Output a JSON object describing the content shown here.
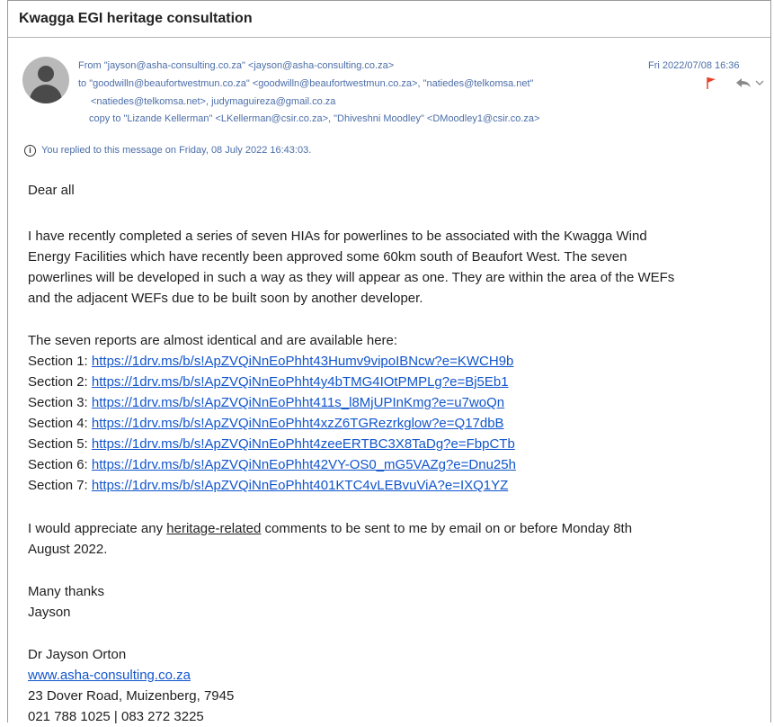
{
  "subject": "Kwagga EGI heritage consultation",
  "header": {
    "from_line": "From \"jayson@asha-consulting.co.za\" <jayson@asha-consulting.co.za>",
    "to_line": "to \"goodwilln@beaufortwestmun.co.za\" <goodwilln@beaufortwestmun.co.za>, \"natiedes@telkomsa.net\"",
    "to_line2": "<natiedes@telkomsa.net>, judymaguireza@gmail.co.za",
    "copy_line": "copy to \"Lizande Kellerman\" <LKellerman@csir.co.za>, \"Dhiveshni Moodley\" <DMoodley1@csir.co.za>",
    "date": "Fri 2022/07/08 16:36"
  },
  "info_bar": "You replied to this message on Friday, 08 July 2022 16:43:03.",
  "body": {
    "greeting": "Dear all",
    "para1_lines": [
      "I have recently completed a series of seven HIAs for powerlines to be associated with the Kwagga Wind",
      "Energy Facilities which have recently been approved some 60km south of Beaufort West. The seven",
      "powerlines will be developed in such a way as they will appear as one. They are within the area of the WEFs",
      "and the adjacent WEFs due to be built soon by another developer."
    ],
    "reports_intro": "The seven reports are almost identical and are available here:",
    "sections": [
      {
        "label": "Section 1: ",
        "url": "https://1drv.ms/b/s!ApZVQiNnEoPhht43Humv9vipoIBNcw?e=KWCH9b"
      },
      {
        "label": "Section 2: ",
        "url": "https://1drv.ms/b/s!ApZVQiNnEoPhht4y4bTMG4IOtPMPLg?e=Bj5Eb1"
      },
      {
        "label": "Section 3: ",
        "url": "https://1drv.ms/b/s!ApZVQiNnEoPhht411s_l8MjUPInKmg?e=u7woQn"
      },
      {
        "label": "Section 4: ",
        "url": "https://1drv.ms/b/s!ApZVQiNnEoPhht4xzZ6TGRezrkglow?e=Q17dbB"
      },
      {
        "label": "Section 5: ",
        "url": "https://1drv.ms/b/s!ApZVQiNnEoPhht4zeeERTBC3X8TaDg?e=FbpCTb"
      },
      {
        "label": "Section 6: ",
        "url": "https://1drv.ms/b/s!ApZVQiNnEoPhht42VY-OS0_mG5VAZg?e=Dnu25h"
      },
      {
        "label": "Section 7: ",
        "url": "https://1drv.ms/b/s!ApZVQiNnEoPhht401KTC4vLEBvuViA?e=IXQ1YZ"
      }
    ],
    "para2_before": "I would appreciate any ",
    "para2_underlined": "heritage-related",
    "para2_after": " comments to be sent to me by email on or before Monday 8th",
    "para2_line2": "August 2022.",
    "thanks": "Many thanks",
    "name": "Jayson"
  },
  "signature": {
    "name": "Dr Jayson Orton",
    "website": "www.asha-consulting.co.za",
    "address": "23 Dover Road, Muizenberg, 7945",
    "phone": "021 788 1025 | 083 272 3225"
  },
  "colors": {
    "header_text": "#4c6ea9",
    "link": "#1155cc",
    "flag": "#e8422a"
  }
}
